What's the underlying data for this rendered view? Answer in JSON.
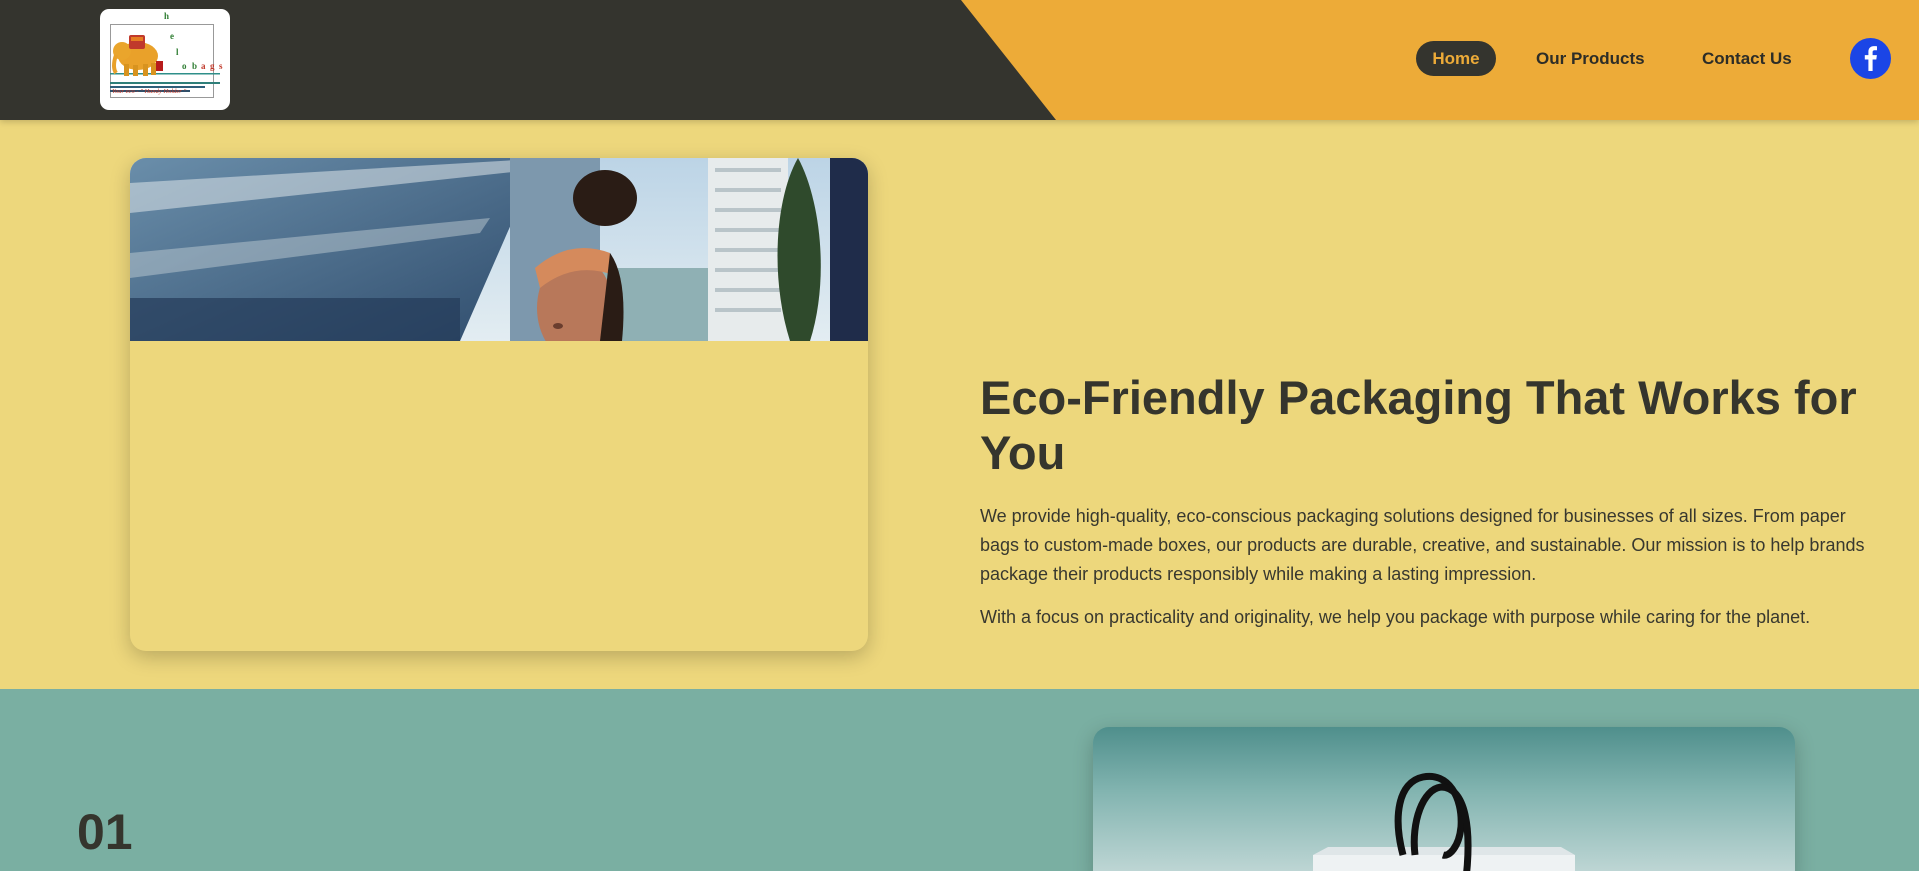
{
  "header": {
    "logo": {
      "letters": [
        "h",
        "e",
        "l",
        "o",
        "b",
        "a",
        "g",
        "s"
      ],
      "tagline": "Your eco - \" Handy Holder \""
    },
    "nav": [
      {
        "label": "Home",
        "active": true
      },
      {
        "label": "Our Products",
        "active": false
      },
      {
        "label": "Contact Us",
        "active": false
      }
    ],
    "social_icon": "facebook-icon",
    "colors": {
      "dark": "#34342e",
      "accent": "#edab38",
      "facebook": "#1b45e6"
    }
  },
  "hero": {
    "title": "Eco-Friendly Packaging That Works for You",
    "paragraph1": "We provide high-quality, eco-conscious packaging solutions designed for businesses of all sizes. From paper bags to custom-made boxes, our products are durable, creative, and sustainable. Our mission is to help brands package their products responsibly while making a lasting impression.",
    "paragraph2": "With a focus on practicality and originality, we help you package with purpose while caring for the planet.",
    "background": "#edd77c"
  },
  "section2": {
    "step_number": "01",
    "background": "#7aafa2"
  }
}
